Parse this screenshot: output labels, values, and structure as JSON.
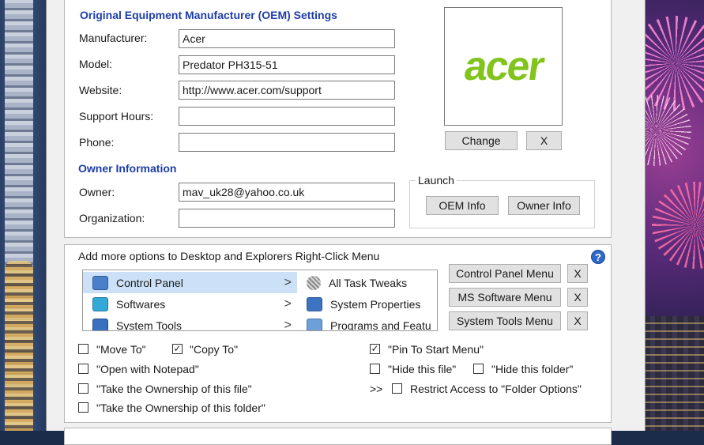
{
  "oem": {
    "title": "Original Equipment Manufacturer (OEM) Settings",
    "fields": [
      {
        "label": "Manufacturer:",
        "value": "Acer"
      },
      {
        "label": "Model:",
        "value": "Predator PH315-51"
      },
      {
        "label": "Website:",
        "value": "http://www.acer.com/support"
      },
      {
        "label": "Support Hours:",
        "value": ""
      },
      {
        "label": "Phone:",
        "value": ""
      }
    ],
    "logo_text": "acer",
    "logo_color": "#80c41c",
    "change_label": "Change",
    "clear_label": "X"
  },
  "owner": {
    "title": "Owner Information",
    "owner_label": "Owner:",
    "owner_value": "mav_uk28@yahoo.co.uk",
    "org_label": "Organization:",
    "org_value": ""
  },
  "launch": {
    "label": "Launch",
    "oem_info": "OEM Info",
    "owner_info": "Owner Info"
  },
  "context_menu": {
    "title": "Add more options to Desktop and Explorers Right-Click Menu",
    "help": "?",
    "left_items": [
      {
        "label": "Control Panel",
        "icon": "control-panel-icon"
      },
      {
        "label": "Softwares",
        "icon": "softwares-icon"
      },
      {
        "label": "System Tools",
        "icon": "system-tools-icon"
      }
    ],
    "right_items": [
      {
        "label": "All Task Tweaks",
        "icon": "task-tweaks-icon"
      },
      {
        "label": "System Properties",
        "icon": "system-properties-icon"
      },
      {
        "label": "Programs and Featu",
        "icon": "programs-icon"
      }
    ],
    "menu_buttons": [
      {
        "label": "Control Panel Menu",
        "x": "X"
      },
      {
        "label": "MS Software Menu",
        "x": "X"
      },
      {
        "label": "System Tools Menu",
        "x": "X"
      }
    ],
    "options": {
      "move_to": "\"Move To\"",
      "copy_to": "\"Copy To\"",
      "open_notepad": "\"Open with Notepad\"",
      "own_file": "\"Take the Ownership of this file\"",
      "own_folder": "\"Take the Ownership of this folder\"",
      "pin_start": "\"Pin To Start Menu\"",
      "hide_file": "\"Hide this file\"",
      "hide_folder": "\"Hide this folder\"",
      "arrows": ">>",
      "restrict": "Restrict Access to \"Folder Options\""
    },
    "checked": {
      "move_to": false,
      "copy_to": true,
      "open_notepad": false,
      "own_file": false,
      "own_folder": false,
      "pin_start": true,
      "hide_file": false,
      "hide_folder": false,
      "restrict": false
    },
    "check_glyph": "✓"
  }
}
